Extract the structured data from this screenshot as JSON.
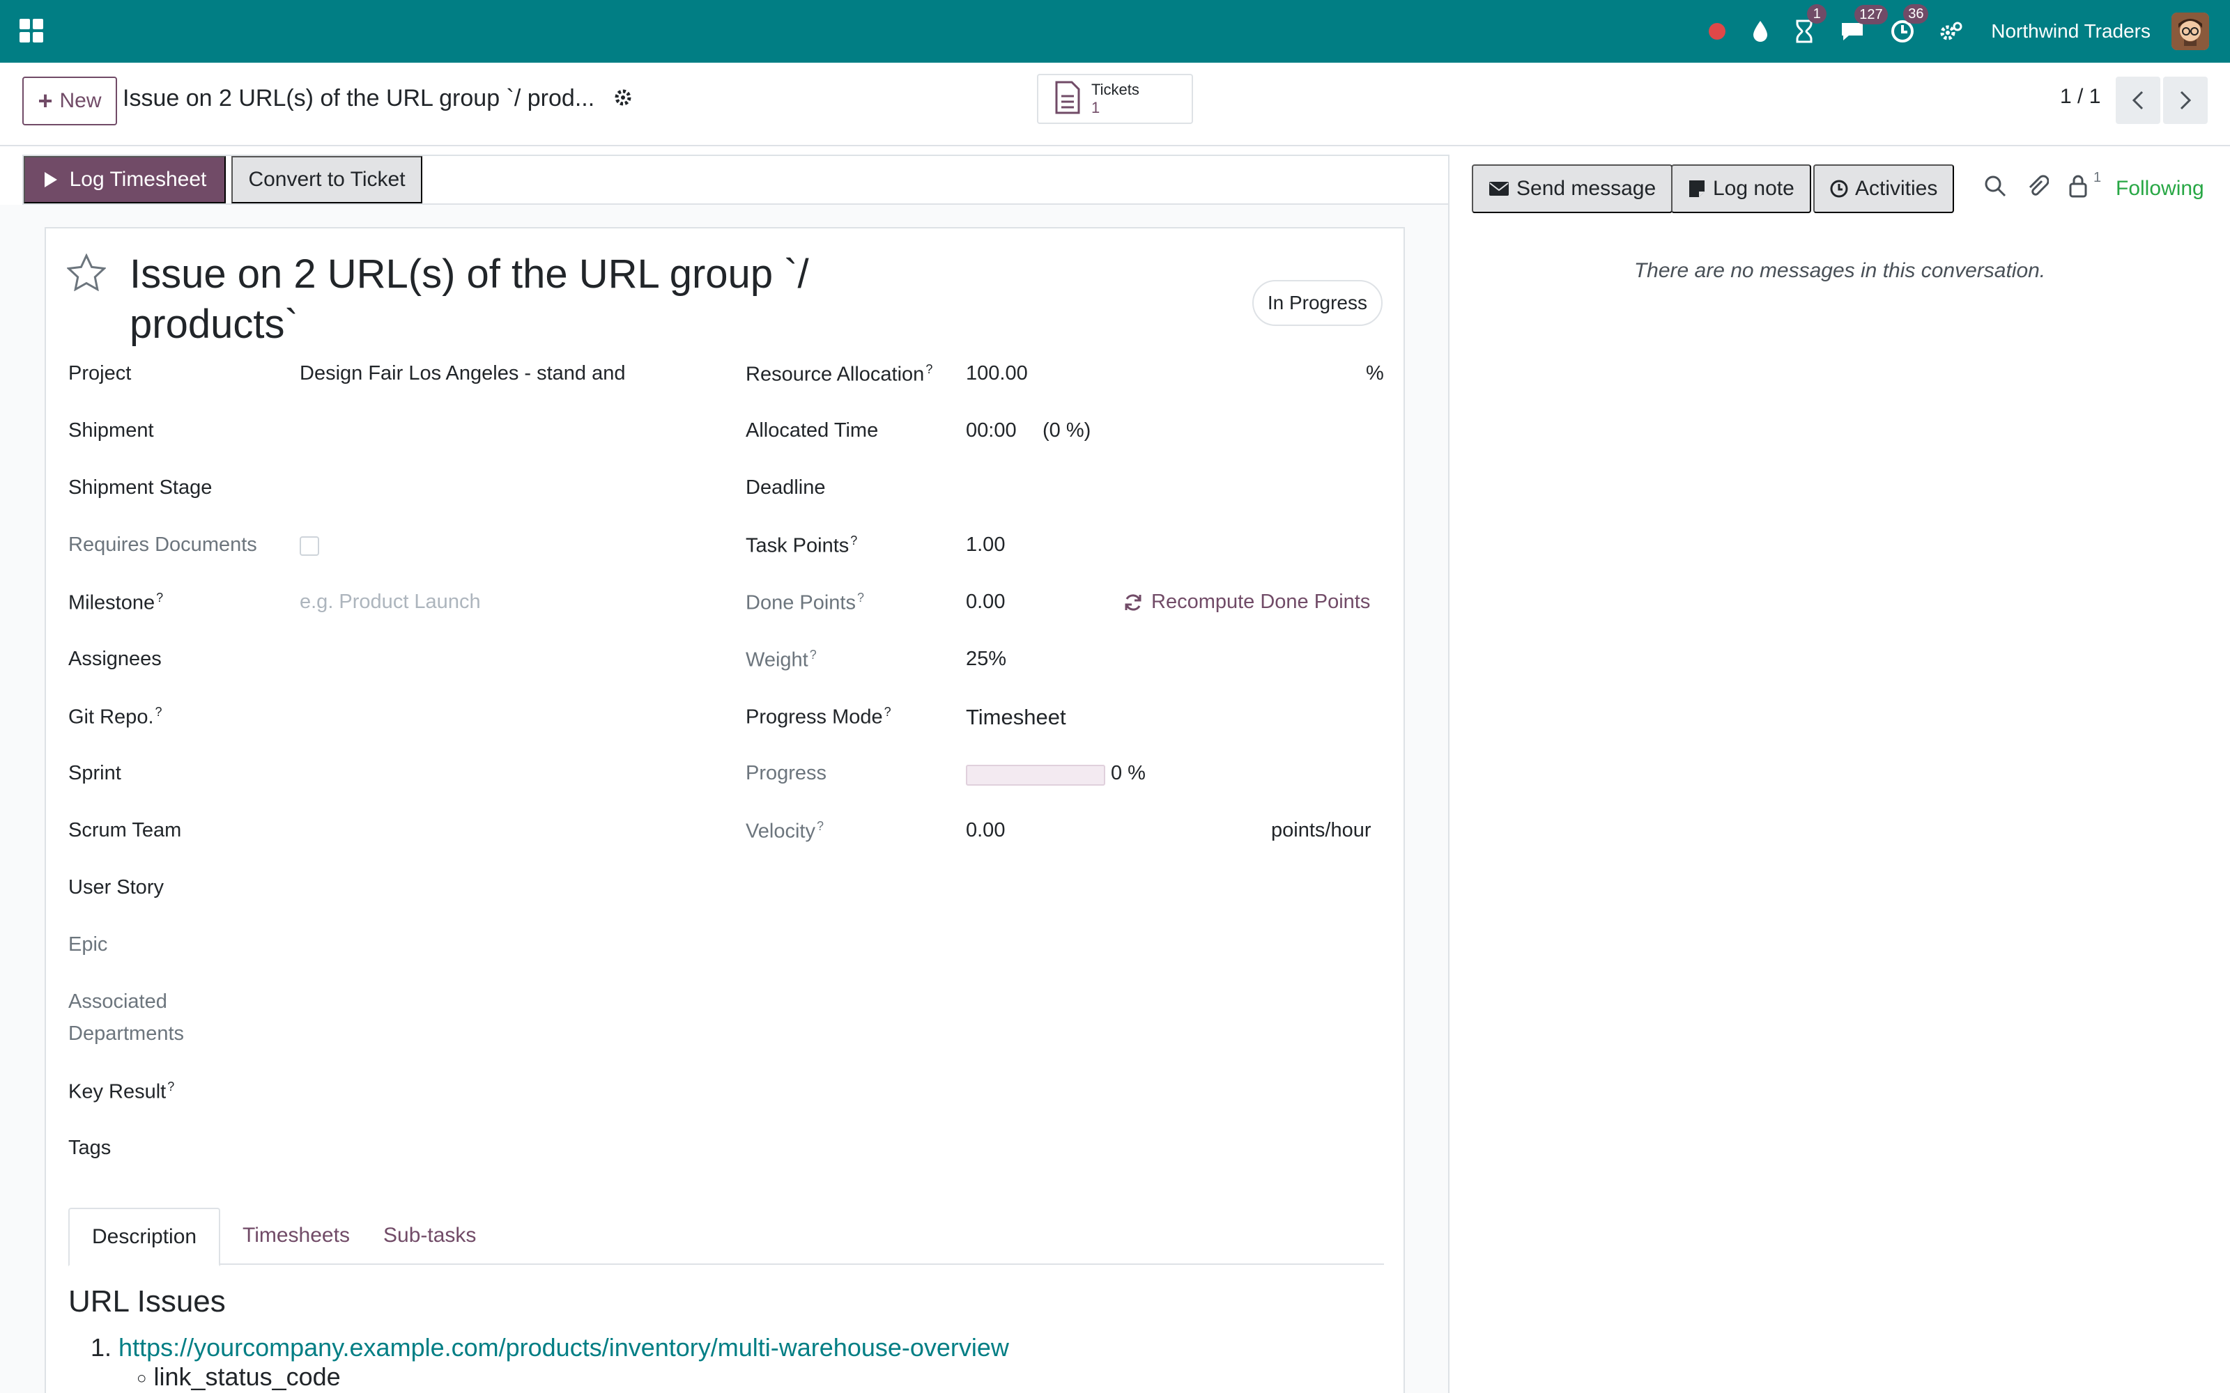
{
  "navbar": {
    "apps_icon": "apps-grid-icon",
    "activity_badge": "1",
    "messages_badge": "127",
    "clock_badge": "36",
    "company": "Northwind Traders",
    "brand_color": "#017e84"
  },
  "control": {
    "new_label": "New",
    "breadcrumb_title": "Issue on 2 URL(s) of the URL group `/ prod...",
    "smart_button": {
      "label": "Tickets",
      "count": "1"
    },
    "pager": "1 / 1"
  },
  "statusbar": {
    "log_timesheet": "Log Timesheet",
    "convert_ticket": "Convert to Ticket"
  },
  "record": {
    "title": "Issue on 2 URL(s) of the URL group `/ products`",
    "stage": "In Progress"
  },
  "fields_left": {
    "project_label": "Project",
    "project_value": "Design Fair Los Angeles - stand and",
    "shipment_label": "Shipment",
    "shipment_stage_label": "Shipment Stage",
    "requires_documents_label": "Requires Documents",
    "milestone_label": "Milestone",
    "milestone_placeholder": "e.g. Product Launch",
    "assignees_label": "Assignees",
    "git_repo_label": "Git Repo.",
    "sprint_label": "Sprint",
    "scrum_team_label": "Scrum Team",
    "user_story_label": "User Story",
    "epic_label": "Epic",
    "associated_label_1": "Associated",
    "associated_label_2": "Departments",
    "key_result_label": "Key Result",
    "tags_label": "Tags"
  },
  "fields_right": {
    "resource_allocation_label": "Resource Allocation",
    "resource_allocation_value": "100.00",
    "resource_allocation_unit": "%",
    "allocated_time_label": "Allocated Time",
    "allocated_time_value": "00:00",
    "allocated_time_pct": "(0 %)",
    "deadline_label": "Deadline",
    "task_points_label": "Task Points",
    "task_points_value": "1.00",
    "done_points_label": "Done Points",
    "done_points_value": "0.00",
    "recompute_label": "Recompute Done Points",
    "weight_label": "Weight",
    "weight_value": "25%",
    "progress_mode_label": "Progress Mode",
    "progress_mode_value": "Timesheet",
    "progress_label": "Progress",
    "progress_value": "0 %",
    "progress_fraction": 0,
    "velocity_label": "Velocity",
    "velocity_value": "0.00",
    "velocity_unit": "points/hour"
  },
  "help_marker": "?",
  "tabs": {
    "description": "Description",
    "timesheets": "Timesheets",
    "subtasks": "Sub-tasks"
  },
  "description": {
    "heading": "URL Issues",
    "item_number": "1.",
    "item_link": "https://yourcompany.example.com/products/inventory/multi-warehouse-overview",
    "sub_item": "link_status_code"
  },
  "chatter": {
    "send_message": "Send message",
    "log_note": "Log note",
    "activities": "Activities",
    "follower_count": "1",
    "following": "Following",
    "no_messages": "There are no messages in this conversation."
  }
}
